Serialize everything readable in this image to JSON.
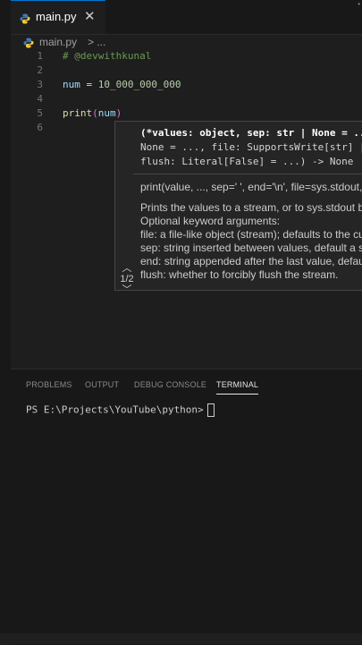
{
  "tabs": [
    {
      "label": "main.py",
      "close": "✕"
    }
  ],
  "breadcrumb": {
    "file": "main.py",
    "separator": "> ..."
  },
  "editor": {
    "lines": [
      {
        "num": "1",
        "text": "# @devwithkunal"
      },
      {
        "num": "2",
        "text": ""
      },
      {
        "num": "3",
        "text": "num = 10_000_000_000"
      },
      {
        "num": "4",
        "text": ""
      },
      {
        "num": "5",
        "text": "print(num)"
      },
      {
        "num": "6",
        "text": ""
      }
    ]
  },
  "hover": {
    "sig_line1": "(*values: object, sep: str | None = ...",
    "sig_line2": "None = ..., file: SupportsWrite[str] |",
    "sig_line3": "flush: Literal[False] = ...) -> None",
    "doc_signature": "print(value, ..., sep=' ', end='\\n', file=sys.stdout,",
    "doc_lines": [
      "Prints the values to a stream, or to sys.stdout by",
      "Optional keyword arguments:",
      "file: a file-like object (stream); defaults to the cu",
      "sep: string inserted between values, default a sp",
      "end: string appended after the last value, defaul",
      "flush: whether to forcibly flush the stream."
    ],
    "counter": "1/2"
  },
  "panel": {
    "tabs": [
      "PROBLEMS",
      "OUTPUT",
      "DEBUG CONSOLE",
      "TERMINAL"
    ],
    "terminal_prompt": "PS E:\\Projects\\YouTube\\python>"
  }
}
